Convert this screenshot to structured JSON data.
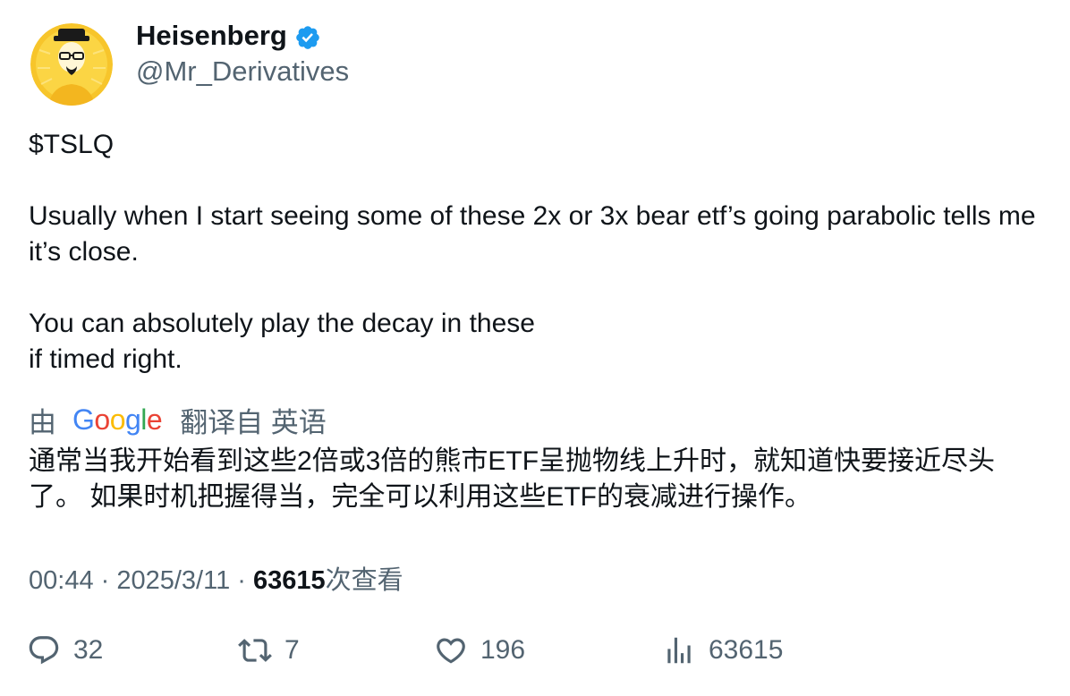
{
  "author": {
    "display_name": "Heisenberg",
    "handle": "@Mr_Derivatives",
    "verified_icon": "verified-badge-icon",
    "avatar_icon": "heisenberg-avatar"
  },
  "tweet": {
    "lines": [
      "$TSLQ",
      "Usually when I start seeing some of these 2x or 3x bear etf’s going parabolic tells me it’s close.",
      "You can absolutely play the decay in these",
      "if timed right."
    ]
  },
  "translation": {
    "by": "由",
    "provider": "Google",
    "from_label": "翻译自 英语",
    "text": "通常当我开始看到这些2倍或3倍的熊市ETF呈抛物线上升时，就知道快要接近尽头了。 如果时机把握得当，完全可以利用这些ETF的衰减进行操作。"
  },
  "meta": {
    "time": "00:44",
    "separator": " · ",
    "date": "2025/3/11",
    "views_count": "63615",
    "views_label": "次查看"
  },
  "actions": {
    "replies": "32",
    "retweets": "7",
    "likes": "196",
    "views": "63615"
  },
  "colors": {
    "text_primary": "#0f1419",
    "text_secondary": "#536471",
    "verified_blue": "#1d9bf0",
    "avatar_yellow": "#f7c52b"
  }
}
